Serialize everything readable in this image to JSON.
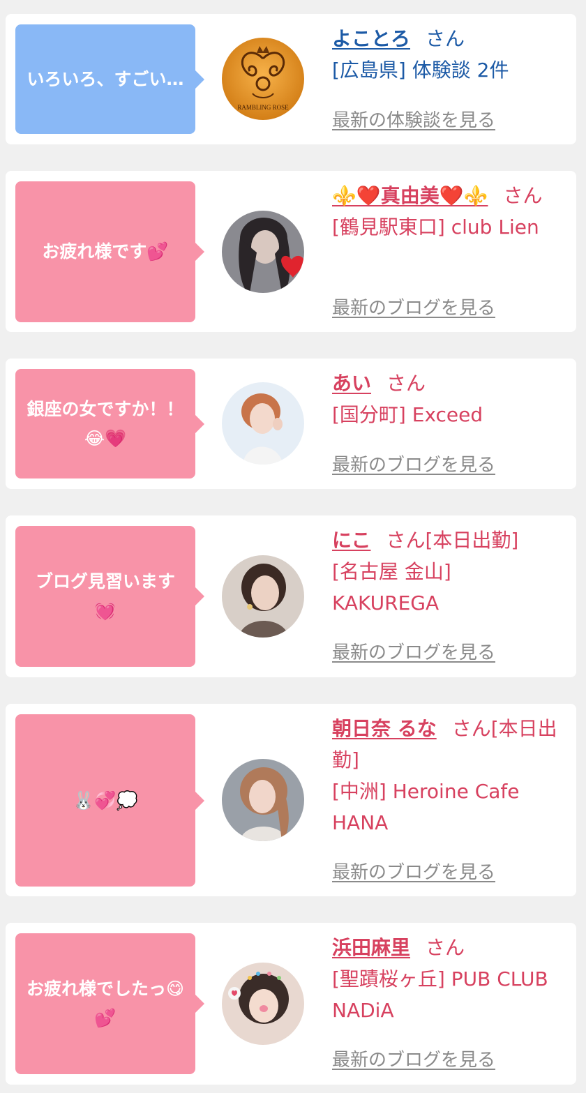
{
  "cards": [
    {
      "message": "いろいろ、すごい…",
      "name": "よことろ",
      "suffix": "さん",
      "shop": "[広島県] 体験談 2件",
      "link": "最新の体験談を見る",
      "avatar_logo_text": "RAMBLING ROSE",
      "colors": {
        "bubble": "#89b8f6",
        "text": "#1c5aa6"
      }
    },
    {
      "message": "お疲れ様です💕",
      "name": "⚜️❤️真由美❤️⚜️",
      "suffix": "さん",
      "shop": "[鶴見駅東口] club Lien",
      "link": "最新のブログを見る",
      "colors": {
        "bubble": "#f893a8",
        "text": "#d7415f"
      }
    },
    {
      "message": "銀座の女ですか！！😂💗",
      "name": "あい",
      "suffix": "さん",
      "shop": "[国分町] Exceed",
      "link": "最新のブログを見る",
      "colors": {
        "bubble": "#f893a8",
        "text": "#d7415f"
      }
    },
    {
      "message": "ブログ見習います💓",
      "name": "にこ",
      "suffix": "さん[本日出勤]",
      "shop": "[名古屋 金山] KAKUREGA",
      "link": "最新のブログを見る",
      "colors": {
        "bubble": "#f893a8",
        "text": "#d7415f"
      }
    },
    {
      "message": "🐰💞💭",
      "name": "朝日奈 るな",
      "suffix": "さん[本日出勤]",
      "shop": "[中洲] Heroine Cafe HANA",
      "link": "最新のブログを見る",
      "colors": {
        "bubble": "#f893a8",
        "text": "#d7415f"
      }
    },
    {
      "message": "お疲れ様でしたっ😋💕",
      "name": "浜田麻里",
      "suffix": "さん",
      "shop": "[聖蹟桜ヶ丘] PUB CLUB NADiA",
      "link": "最新のブログを見る",
      "colors": {
        "bubble": "#f893a8",
        "text": "#d7415f"
      }
    }
  ]
}
